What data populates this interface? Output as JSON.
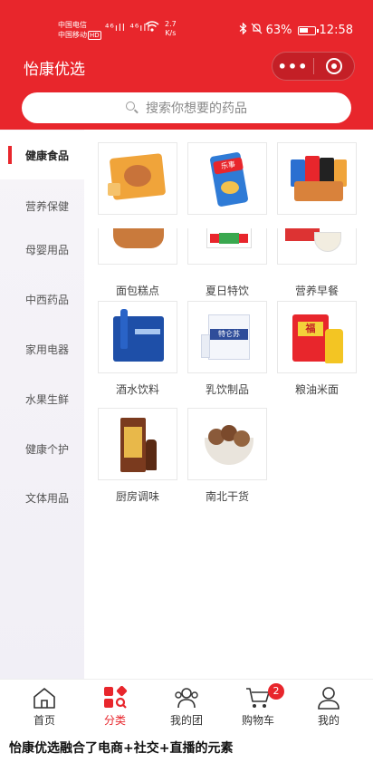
{
  "status_bar": {
    "carrier_top": "中国电信",
    "carrier_bottom": "中国移动",
    "hd": "HD",
    "signal": "⁴⁶ıll ⁴⁶ıll",
    "net_speed_value": "2.7",
    "net_speed_unit": "K/s",
    "battery_percent": "63%",
    "time": "12:58"
  },
  "header": {
    "title": "怡康优选",
    "more_label": "•••"
  },
  "search": {
    "placeholder": "搜索你想要的药品"
  },
  "sidebar": {
    "items": [
      {
        "label": "健康食品",
        "active": true
      },
      {
        "label": "营养保健",
        "active": false
      },
      {
        "label": "母婴用品",
        "active": false
      },
      {
        "label": "中西药品",
        "active": false
      },
      {
        "label": "家用电器",
        "active": false
      },
      {
        "label": "水果生鲜",
        "active": false
      },
      {
        "label": "健康个护",
        "active": false
      },
      {
        "label": "文体用品",
        "active": false
      }
    ]
  },
  "products": {
    "row1": [
      "",
      "",
      ""
    ],
    "row2": [
      "面包糕点",
      "夏日特饮",
      "营养早餐"
    ],
    "row3": [
      "酒水饮料",
      "乳饮制品",
      "粮油米面"
    ],
    "row4": [
      "厨房调味",
      "南北干货"
    ]
  },
  "product_image_text": {
    "chips_brand": "乐事",
    "milk_brand": "特仑苏",
    "oil_brand": "福"
  },
  "tabbar": {
    "tabs": [
      {
        "label": "首页",
        "icon": "home-icon",
        "active": false
      },
      {
        "label": "分类",
        "icon": "category-icon",
        "active": true
      },
      {
        "label": "我的团",
        "icon": "group-icon",
        "active": false
      },
      {
        "label": "购物车",
        "icon": "cart-icon",
        "active": false
      },
      {
        "label": "我的",
        "icon": "user-icon",
        "active": false
      }
    ],
    "cart_count": "2"
  },
  "caption": "怡康优选融合了电商+社交+直播的元素",
  "colors": {
    "brand_red": "#e8262c",
    "sidebar_bg": "#f3f1f7"
  }
}
